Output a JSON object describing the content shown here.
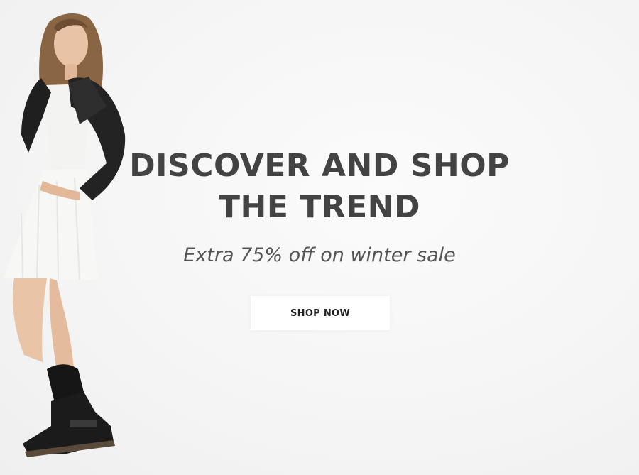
{
  "hero": {
    "headline_line1": "DISCOVER AND SHOP",
    "headline_line2": "THE TREND",
    "subheadline": "Extra 75% off on winter sale",
    "cta_label": "SHOP NOW",
    "colors": {
      "headline": "#434343",
      "subheadline": "#555555",
      "cta_text": "#222222",
      "cta_background": "#ffffff",
      "background": "#f7f7f7"
    },
    "image": "fashion-model-photo"
  }
}
